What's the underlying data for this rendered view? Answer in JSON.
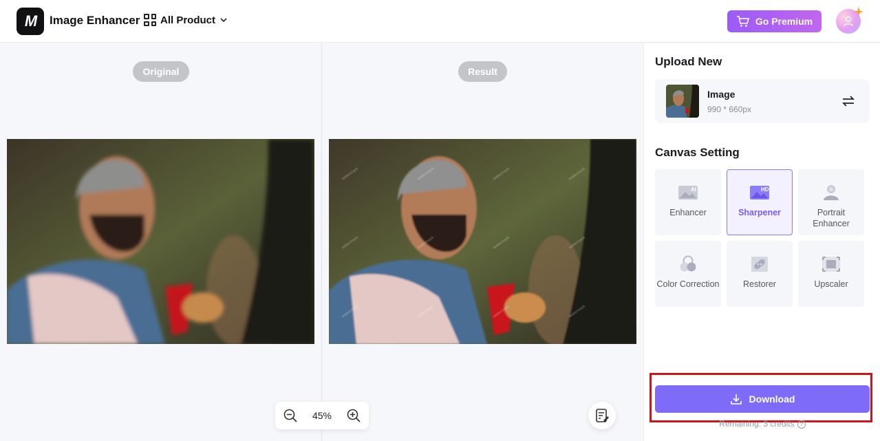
{
  "header": {
    "logo_text": "M",
    "app_title": "Image Enhancer",
    "all_product_label": "All Product",
    "premium_label": "Go Premium"
  },
  "canvas": {
    "original_label": "Original",
    "result_label": "Result",
    "zoom_level": "45%"
  },
  "sidebar": {
    "upload_title": "Upload New",
    "image_name": "Image",
    "image_dims": "990 * 660px",
    "canvas_title": "Canvas Setting",
    "tools": [
      {
        "label": "Enhancer",
        "icon": "ai-image-icon",
        "active": false
      },
      {
        "label": "Sharpener",
        "icon": "hd-image-icon",
        "active": true
      },
      {
        "label": "Portrait Enhancer",
        "icon": "portrait-icon",
        "active": false
      },
      {
        "label": "Color Correction",
        "icon": "color-circles-icon",
        "active": false
      },
      {
        "label": "Restorer",
        "icon": "bandage-icon",
        "active": false
      },
      {
        "label": "Upscaler",
        "icon": "upscale-icon",
        "active": false
      }
    ],
    "download_label": "Download",
    "remaining_text": "Remaining: 3 credits"
  },
  "colors": {
    "accent": "#7e6cf8",
    "premium_gradient_start": "#9a5cf6",
    "premium_gradient_end": "#c266ee",
    "highlight_border": "#d1121b"
  }
}
